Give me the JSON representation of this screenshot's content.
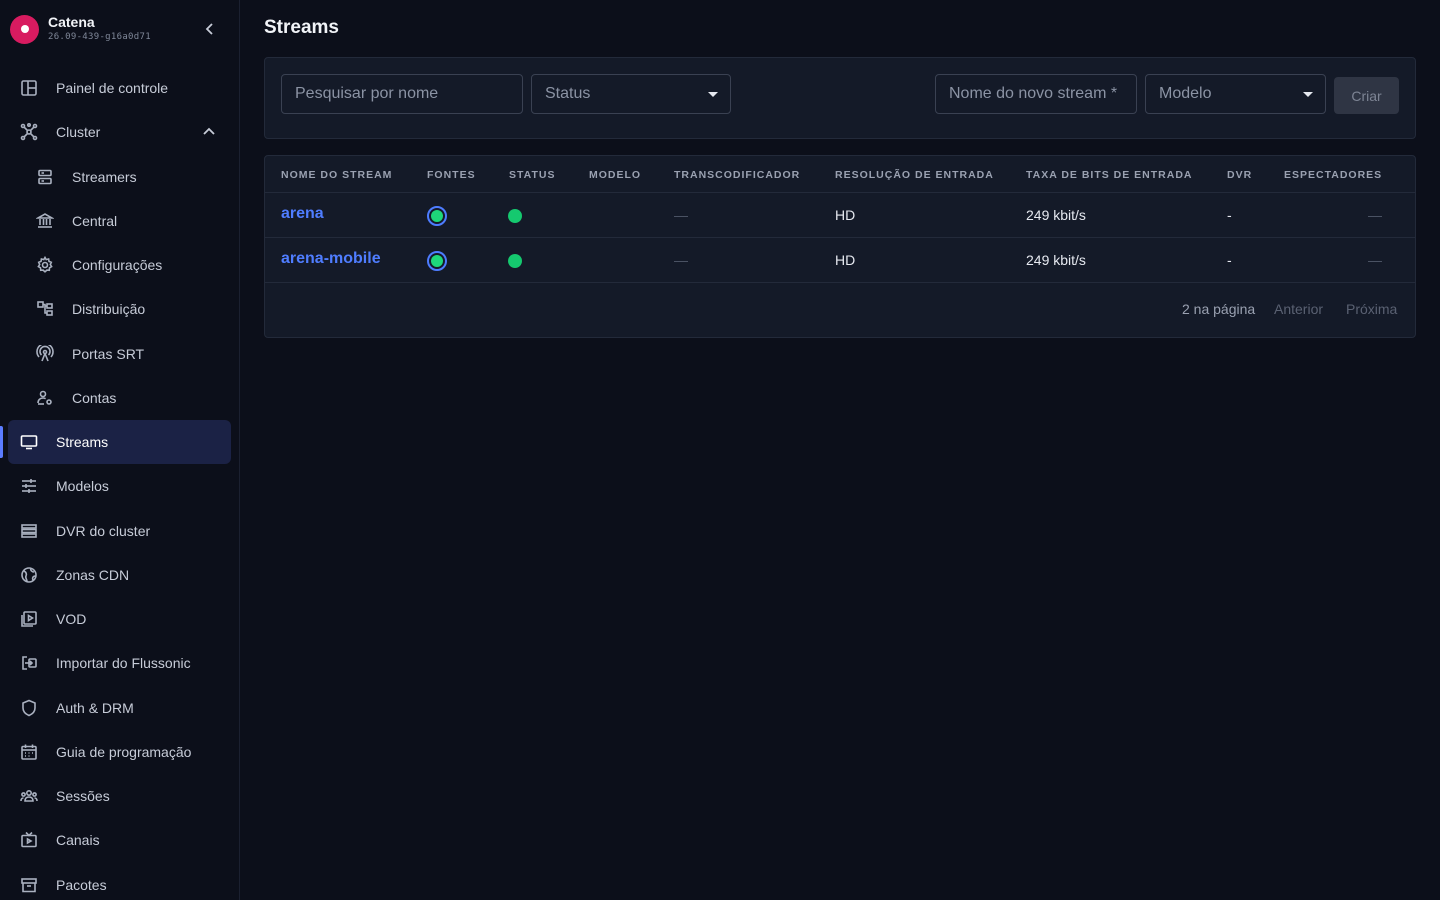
{
  "app": {
    "name": "Catena",
    "version": "26.09-439-g16a0d71"
  },
  "sidebar": {
    "items": [
      {
        "label": "Painel de controle",
        "icon": "dashboard-icon"
      },
      {
        "label": "Cluster",
        "icon": "cluster-icon"
      },
      {
        "label": "Streamers",
        "icon": "server-icon"
      },
      {
        "label": "Central",
        "icon": "bank-icon"
      },
      {
        "label": "Configurações",
        "icon": "gear-icon"
      },
      {
        "label": "Distribuição",
        "icon": "distribution-icon"
      },
      {
        "label": "Portas SRT",
        "icon": "antenna-icon"
      },
      {
        "label": "Contas",
        "icon": "user-settings-icon"
      },
      {
        "label": "Streams",
        "icon": "monitor-icon"
      },
      {
        "label": "Modelos",
        "icon": "sliders-icon"
      },
      {
        "label": "DVR do cluster",
        "icon": "storage-icon"
      },
      {
        "label": "Zonas CDN",
        "icon": "globe-icon"
      },
      {
        "label": "VOD",
        "icon": "video-library-icon"
      },
      {
        "label": "Importar do Flussonic",
        "icon": "import-icon"
      },
      {
        "label": "Auth & DRM",
        "icon": "shield-icon"
      },
      {
        "label": "Guia de programação",
        "icon": "calendar-icon"
      },
      {
        "label": "Sessões",
        "icon": "group-icon"
      },
      {
        "label": "Canais",
        "icon": "tv-icon"
      },
      {
        "label": "Pacotes",
        "icon": "package-icon"
      }
    ],
    "active": "Streams"
  },
  "page": {
    "title": "Streams"
  },
  "toolbar": {
    "search_placeholder": "Pesquisar por nome",
    "status_label": "Status",
    "new_stream_placeholder": "Nome do novo stream *",
    "model_label": "Modelo",
    "create_label": "Criar"
  },
  "table": {
    "headers": [
      "Nome do stream",
      "Fontes",
      "Status",
      "Modelo",
      "Transcodificador",
      "Resolução de entrada",
      "Taxa de bits de entrada",
      "DVR",
      "Espectadores"
    ],
    "rows": [
      {
        "name": "arena",
        "model": "",
        "transcoder": "—",
        "resolution": "HD",
        "bitrate": "249 kbit/s",
        "dvr": "-",
        "viewers": "—"
      },
      {
        "name": "arena-mobile",
        "model": "",
        "transcoder": "—",
        "resolution": "HD",
        "bitrate": "249 kbit/s",
        "dvr": "-",
        "viewers": "—"
      }
    ]
  },
  "pagination": {
    "info": "2 na página",
    "prev": "Anterior",
    "next": "Próxima"
  },
  "colors": {
    "accent": "#4f7dff",
    "brand": "#d81b60",
    "status_ok": "#15c96f",
    "active_nav_bg": "#1b2245"
  }
}
